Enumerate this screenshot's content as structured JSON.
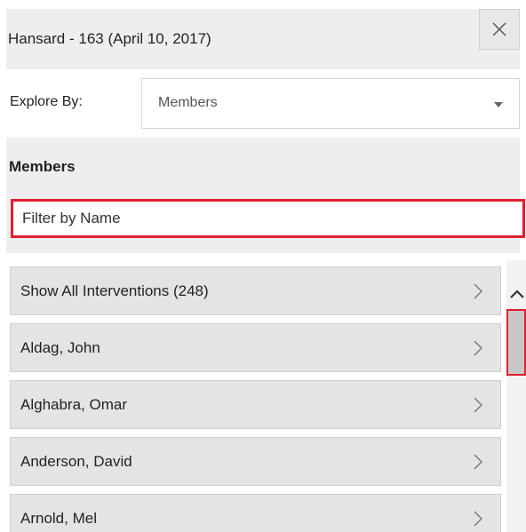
{
  "header": {
    "title": "Hansard - 163 (April 10, 2017)",
    "close_icon": "close-icon"
  },
  "explore": {
    "label": "Explore By:",
    "selected": "Members"
  },
  "members": {
    "heading": "Members",
    "filter_placeholder": "Filter by Name"
  },
  "list": {
    "items": [
      {
        "label": "Show All Interventions (248)"
      },
      {
        "label": "Aldag, John"
      },
      {
        "label": "Alghabra, Omar"
      },
      {
        "label": "Anderson, David"
      },
      {
        "label": "Arnold, Mel"
      }
    ]
  },
  "colors": {
    "focus_outline": "#e02030",
    "panel_bg": "#eeeeee",
    "item_bg": "#e4e4e4"
  }
}
